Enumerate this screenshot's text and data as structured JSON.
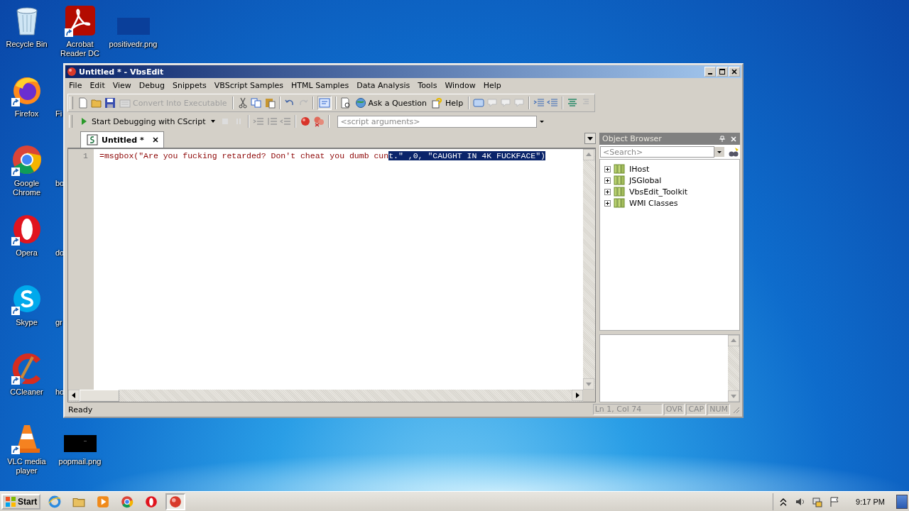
{
  "desktop": {
    "columns": [
      [
        {
          "label": "Recycle Bin",
          "kind": "recycle"
        },
        {
          "label": "Firefox",
          "kind": "firefox",
          "shortcut": true
        },
        {
          "label": "Google Chrome",
          "kind": "chrome",
          "shortcut": true
        },
        {
          "label": "Opera",
          "kind": "opera",
          "shortcut": true
        },
        {
          "label": "Skype",
          "kind": "skype",
          "shortcut": true
        },
        {
          "label": "CCleaner",
          "kind": "ccleaner",
          "shortcut": true
        },
        {
          "label": "VLC media player",
          "kind": "vlc",
          "shortcut": true
        }
      ],
      [
        {
          "label": "Acrobat Reader DC",
          "kind": "acrobat",
          "shortcut": true
        },
        {
          "label": "Fi",
          "kind": "covered"
        },
        {
          "label": "bo",
          "kind": "covered"
        },
        {
          "label": "do",
          "kind": "covered"
        },
        {
          "label": "gr",
          "kind": "covered"
        },
        {
          "label": "ho",
          "kind": "covered"
        },
        {
          "label": "popmail.png",
          "kind": "image-dark"
        }
      ],
      [
        {
          "label": "positivedr.png",
          "kind": "image-blue"
        }
      ]
    ]
  },
  "window": {
    "title": "Untitled * - VbsEdit",
    "menu": [
      "File",
      "Edit",
      "View",
      "Debug",
      "Snippets",
      "VBScript Samples",
      "HTML Samples",
      "Data Analysis",
      "Tools",
      "Window",
      "Help"
    ],
    "toolbar": [
      {
        "label": "Convert Into Executable",
        "disabled": true
      },
      {
        "label": "Ask a Question",
        "disabled": false
      },
      {
        "label": "Help",
        "disabled": false
      }
    ],
    "debug_button": {
      "label": "Start Debugging with CScript"
    },
    "arguments_field": {
      "placeholder": "<script arguments>"
    },
    "tabs": [
      {
        "label": "Untitled *",
        "selected": true
      }
    ],
    "editor": {
      "lines": [
        {
          "number": "1",
          "segments": [
            {
              "text": "=msgbox(\"Are you fucking retarded? Don't cheat you dumb cun",
              "selected": false
            },
            {
              "text": "t.\" ,0, \"CAUGHT IN 4K FUCKFACE\")",
              "selected": true
            }
          ]
        }
      ]
    },
    "object_browser": {
      "title": "Object Browser",
      "search": {
        "placeholder": "<Search>"
      },
      "items": [
        {
          "label": "IHost",
          "expanded": false
        },
        {
          "label": "JSGlobal",
          "expanded": false
        },
        {
          "label": "VbsEdit_Toolkit",
          "expanded": false
        },
        {
          "label": "WMI Classes",
          "expanded": false
        }
      ]
    },
    "status_bar": {
      "message": "Ready",
      "position": "Ln 1, Col 74",
      "indicators": [
        "OVR",
        "CAP",
        "NUM"
      ]
    }
  },
  "taskbar": {
    "start": "Start",
    "apps": [
      {
        "kind": "ie",
        "selected": false
      },
      {
        "kind": "folder",
        "selected": false
      },
      {
        "kind": "media",
        "selected": false
      },
      {
        "kind": "chrome",
        "selected": false
      },
      {
        "kind": "opera",
        "selected": false
      },
      {
        "kind": "vbsedit",
        "selected": true
      }
    ],
    "clock": "9:17 PM"
  }
}
